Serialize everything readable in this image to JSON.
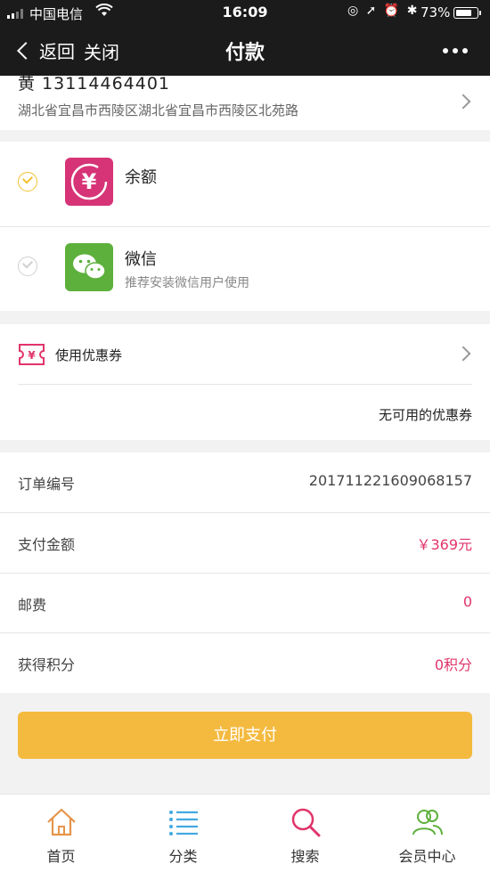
{
  "status_bar": {
    "carrier": "中国电信",
    "time": "16:09",
    "battery_pct": "73%"
  },
  "nav": {
    "back_label": "返回",
    "close_label": "关闭",
    "title": "付款"
  },
  "address": {
    "name_phone": "黄   13114464401",
    "address_line": "湖北省宜昌市西陵区湖北省宜昌市西陵区北苑路"
  },
  "payment_methods": [
    {
      "title": "余额",
      "subtitle": "",
      "selected": true,
      "icon": "yuan-balance-icon",
      "color": "#d63477"
    },
    {
      "title": "微信",
      "subtitle": "推荐安装微信用户使用",
      "selected": false,
      "icon": "wechat-icon",
      "color": "#5db03c"
    }
  ],
  "coupon": {
    "label": "使用优惠券",
    "status": "无可用的优惠券",
    "icon": "coupon-ticket-icon"
  },
  "order_info": [
    {
      "key": "订单编号",
      "value": "20171122160906815​7"
    },
    {
      "key": "支付金额",
      "value": "￥369元"
    },
    {
      "key": "邮费",
      "value": "0"
    },
    {
      "key": "获得积分",
      "value": "0积分"
    }
  ],
  "pay_button": {
    "label": "立即支付",
    "color": "#f4ba3f"
  },
  "tabbar": [
    {
      "label": "首页",
      "icon": "home-icon"
    },
    {
      "label": "分类",
      "icon": "list-icon"
    },
    {
      "label": "搜索",
      "icon": "search-icon"
    },
    {
      "label": "会员中心",
      "icon": "member-icon"
    }
  ],
  "colors": {
    "accent_red": "#e1346a",
    "select_yellow": "#f2c12e",
    "topbar": "#1b1b1b"
  }
}
